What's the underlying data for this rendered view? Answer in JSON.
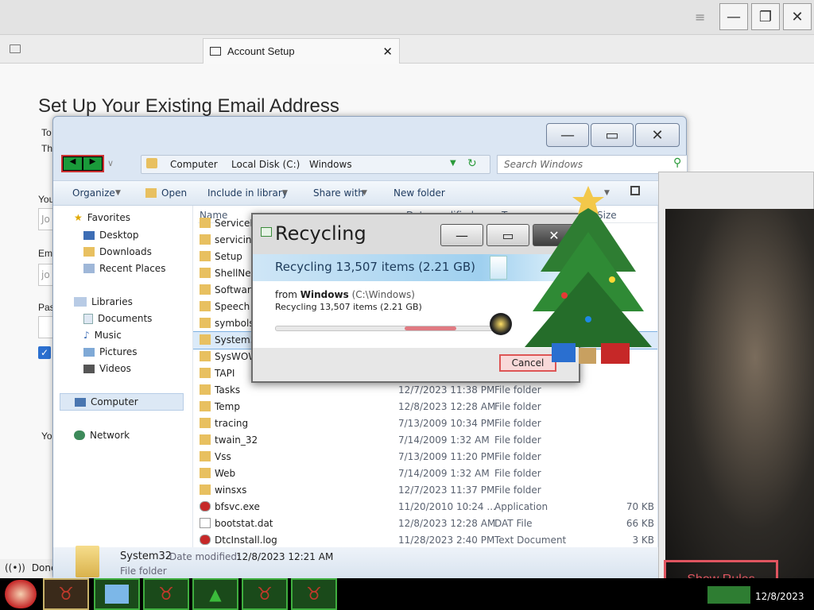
{
  "thunderbird": {
    "tab_label": "Account Setup",
    "setup_title": "Set Up Your Existing Email Address",
    "side_texts": [
      "To",
      "Th",
      "You",
      "Jo",
      "Em",
      "jo",
      "Pas",
      "Yo"
    ],
    "status": "Done"
  },
  "explorer": {
    "breadcrumb": [
      "Computer",
      "Local Disk (C:)",
      "Windows"
    ],
    "search_placeholder": "Search Windows",
    "toolbar": [
      "Organize",
      "Open",
      "Include in library",
      "Share with",
      "New folder"
    ],
    "columns": [
      "Name",
      "Date modified",
      "Type",
      "Size"
    ],
    "nav": {
      "favorites": "Favorites",
      "favorites_items": [
        "Desktop",
        "Downloads",
        "Recent Places"
      ],
      "libraries": "Libraries",
      "libraries_items": [
        "Documents",
        "Music",
        "Pictures",
        "Videos"
      ],
      "computer": "Computer",
      "network": "Network"
    },
    "files": [
      {
        "name": "ServiceP",
        "date": "",
        "type": "",
        "size": ""
      },
      {
        "name": "servicing",
        "date": "",
        "type": "",
        "size": ""
      },
      {
        "name": "Setup",
        "date": "",
        "type": "",
        "size": ""
      },
      {
        "name": "ShellNew",
        "date": "",
        "type": "",
        "size": ""
      },
      {
        "name": "Software",
        "date": "",
        "type": "",
        "size": ""
      },
      {
        "name": "Speech",
        "date": "",
        "type": "",
        "size": ""
      },
      {
        "name": "symbols",
        "date": "",
        "type": "",
        "size": ""
      },
      {
        "name": "System3",
        "date": "",
        "type": "",
        "size": ""
      },
      {
        "name": "SysWOW",
        "date": "",
        "type": "",
        "size": ""
      },
      {
        "name": "TAPI",
        "date": "",
        "type": "",
        "size": ""
      },
      {
        "name": "Tasks",
        "date": "12/7/2023 11:38 PM",
        "type": "File folder",
        "size": ""
      },
      {
        "name": "Temp",
        "date": "12/8/2023 12:28 AM",
        "type": "File folder",
        "size": ""
      },
      {
        "name": "tracing",
        "date": "7/13/2009 10:34 PM",
        "type": "File folder",
        "size": ""
      },
      {
        "name": "twain_32",
        "date": "7/14/2009 1:32 AM",
        "type": "File folder",
        "size": ""
      },
      {
        "name": "Vss",
        "date": "7/13/2009 11:20 PM",
        "type": "File folder",
        "size": ""
      },
      {
        "name": "Web",
        "date": "7/14/2009 1:32 AM",
        "type": "File folder",
        "size": ""
      },
      {
        "name": "winsxs",
        "date": "12/7/2023 11:37 PM",
        "type": "File folder",
        "size": ""
      },
      {
        "name": "bfsvc.exe",
        "date": "11/20/2010 10:24 ...",
        "type": "Application",
        "size": "70 KB"
      },
      {
        "name": "bootstat.dat",
        "date": "12/8/2023 12:28 AM",
        "type": "DAT File",
        "size": "66 KB"
      },
      {
        "name": "DtcInstall.log",
        "date": "11/28/2023 2:40 PM",
        "type": "Text Document",
        "size": "3 KB"
      }
    ],
    "details": {
      "name": "System32",
      "date_label": "Date modified:",
      "date": "12/8/2023 12:21 AM",
      "type": "File folder"
    }
  },
  "recycling": {
    "title": "Recycling",
    "headline": "Recycling 13,507 items (2.21 GB)",
    "from_label": "from",
    "from_bold": "Windows",
    "from_path": "(C:\\Windows)",
    "sub": "Recycling 13,507 items (2.21 GB)",
    "cancel": "Cancel",
    "progress": 0.5
  },
  "photo": {
    "show_rules": "Show Rules"
  },
  "taskbar": {
    "clock": "12/8/2023"
  },
  "colors": {
    "accent_red": "#e0505a",
    "task_green": "#3fae3f"
  }
}
